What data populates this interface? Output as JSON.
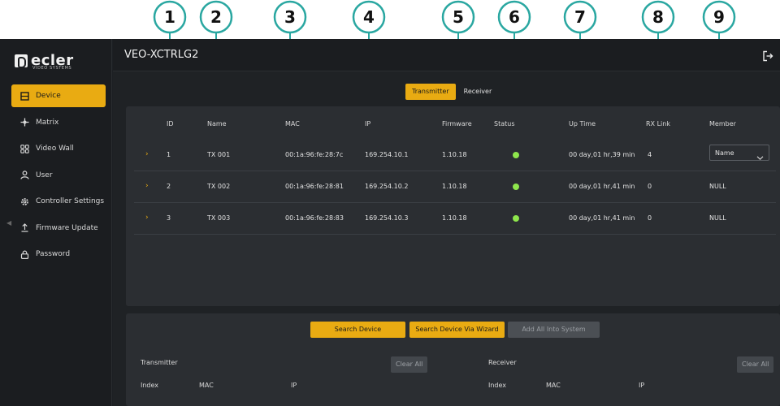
{
  "callouts": [
    "1",
    "2",
    "3",
    "4",
    "5",
    "6",
    "7",
    "8",
    "9"
  ],
  "brand": {
    "name": "ecler",
    "sub": "VIDEO SYSTEMS"
  },
  "app_title": "VEO-XCTRLG2",
  "sidebar": {
    "items": [
      {
        "label": "Device",
        "icon": "device-icon",
        "active": true
      },
      {
        "label": "Matrix",
        "icon": "matrix-icon",
        "active": false
      },
      {
        "label": "Video Wall",
        "icon": "video-wall-icon",
        "active": false
      },
      {
        "label": "User",
        "icon": "user-icon",
        "active": false
      },
      {
        "label": "Controller Settings",
        "icon": "gear-icon",
        "active": false
      },
      {
        "label": "Firmware Update",
        "icon": "upload-icon",
        "active": false
      },
      {
        "label": "Password",
        "icon": "lock-icon",
        "active": false
      }
    ]
  },
  "tabs": {
    "transmitter": "Transmitter",
    "receiver": "Receiver",
    "active": "Transmitter"
  },
  "table": {
    "headers": [
      "ID",
      "Name",
      "MAC",
      "IP",
      "Firmware",
      "Status",
      "Up Time",
      "RX Link",
      "Member"
    ],
    "rows": [
      {
        "id": "1",
        "name": "TX 001",
        "mac": "00:1a:96:fe:28:7c",
        "ip": "169.254.10.1",
        "firmware": "1.10.18",
        "status": "online",
        "uptime": "00 day,01 hr,39 min",
        "rx": "4",
        "member": "Name",
        "member_select": true
      },
      {
        "id": "2",
        "name": "TX 002",
        "mac": "00:1a:96:fe:28:81",
        "ip": "169.254.10.2",
        "firmware": "1.10.18",
        "status": "online",
        "uptime": "00 day,01 hr,41 min",
        "rx": "0",
        "member": "NULL",
        "member_select": false
      },
      {
        "id": "3",
        "name": "TX 003",
        "mac": "00:1a:96:fe:28:83",
        "ip": "169.254.10.3",
        "firmware": "1.10.18",
        "status": "online",
        "uptime": "00 day,01 hr,41 min",
        "rx": "0",
        "member": "NULL",
        "member_select": false
      }
    ]
  },
  "actions": {
    "search": "Search Device",
    "wizard": "Search Device Via Wizard",
    "add_all": "Add All Into System"
  },
  "discovered": {
    "transmitter": {
      "title": "Transmitter",
      "clear": "Clear All",
      "cols": [
        "Index",
        "MAC",
        "IP"
      ]
    },
    "receiver": {
      "title": "Receiver",
      "clear": "Clear All",
      "cols": [
        "Index",
        "MAC",
        "IP"
      ]
    }
  },
  "colors": {
    "accent": "#e9ab12",
    "callout": "#2aa7a1",
    "status_online": "#8ee64c"
  }
}
